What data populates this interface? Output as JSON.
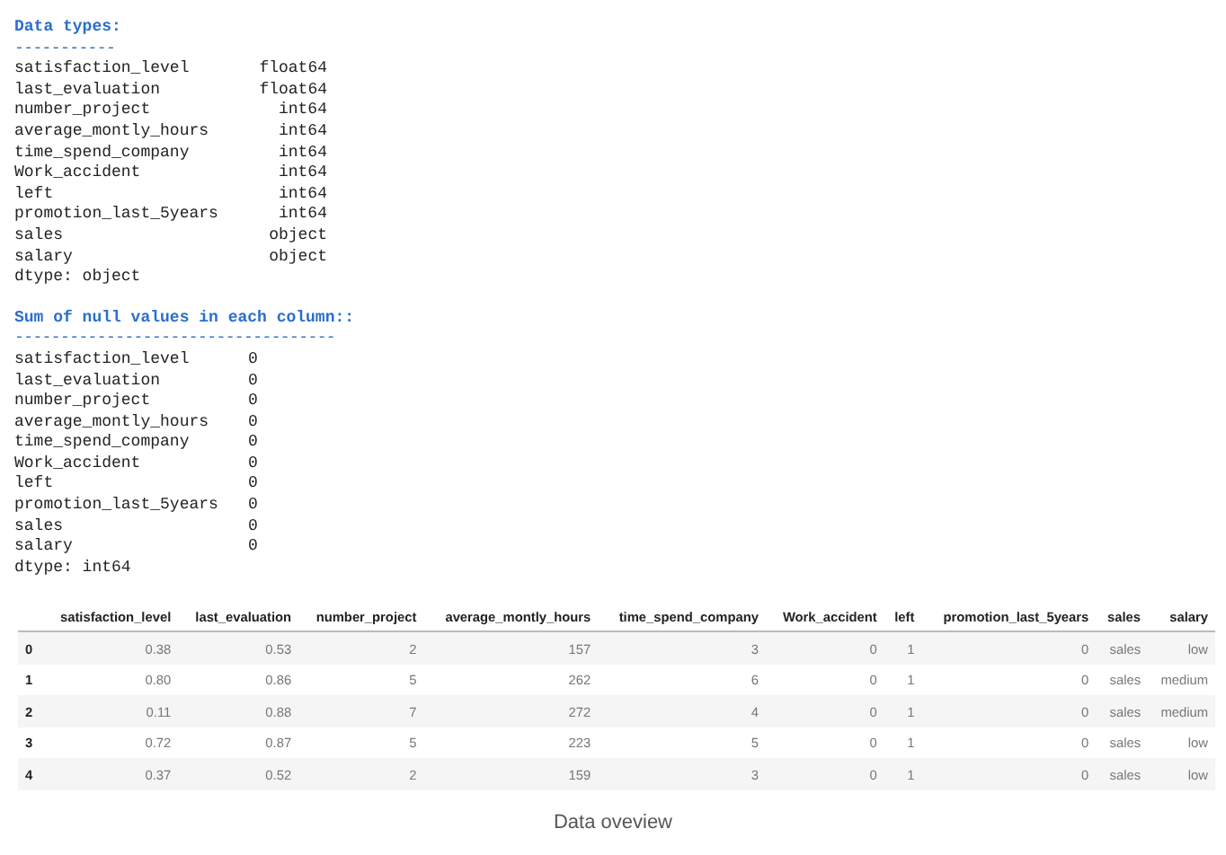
{
  "sections": [
    {
      "title": "Data types:",
      "divider": "-----------",
      "kind": "types",
      "rows": [
        {
          "name": "satisfaction_level",
          "value": "float64"
        },
        {
          "name": "last_evaluation",
          "value": "float64"
        },
        {
          "name": "number_project",
          "value": "int64"
        },
        {
          "name": "average_montly_hours",
          "value": "int64"
        },
        {
          "name": "time_spend_company",
          "value": "int64"
        },
        {
          "name": "Work_accident",
          "value": "int64"
        },
        {
          "name": "left",
          "value": "int64"
        },
        {
          "name": "promotion_last_5years",
          "value": "int64"
        },
        {
          "name": "sales",
          "value": "object"
        },
        {
          "name": "salary",
          "value": "object"
        }
      ],
      "dtype": "dtype: object"
    },
    {
      "title": "Sum of null values in each column::",
      "divider": "-----------------------------------",
      "kind": "nulls",
      "rows": [
        {
          "name": "satisfaction_level",
          "value": "0"
        },
        {
          "name": "last_evaluation",
          "value": "0"
        },
        {
          "name": "number_project",
          "value": "0"
        },
        {
          "name": "average_montly_hours",
          "value": "0"
        },
        {
          "name": "time_spend_company",
          "value": "0"
        },
        {
          "name": "Work_accident",
          "value": "0"
        },
        {
          "name": "left",
          "value": "0"
        },
        {
          "name": "promotion_last_5years",
          "value": "0"
        },
        {
          "name": "sales",
          "value": "0"
        },
        {
          "name": "salary",
          "value": "0"
        }
      ],
      "dtype": "dtype: int64"
    }
  ],
  "table": {
    "columns": [
      "satisfaction_level",
      "last_evaluation",
      "number_project",
      "average_montly_hours",
      "time_spend_company",
      "Work_accident",
      "left",
      "promotion_last_5years",
      "sales",
      "salary"
    ],
    "rows": [
      {
        "index": "0",
        "cells": [
          "0.38",
          "0.53",
          "2",
          "157",
          "3",
          "0",
          "1",
          "0",
          "sales",
          "low"
        ]
      },
      {
        "index": "1",
        "cells": [
          "0.80",
          "0.86",
          "5",
          "262",
          "6",
          "0",
          "1",
          "0",
          "sales",
          "medium"
        ]
      },
      {
        "index": "2",
        "cells": [
          "0.11",
          "0.88",
          "7",
          "272",
          "4",
          "0",
          "1",
          "0",
          "sales",
          "medium"
        ]
      },
      {
        "index": "3",
        "cells": [
          "0.72",
          "0.87",
          "5",
          "223",
          "5",
          "0",
          "1",
          "0",
          "sales",
          "low"
        ]
      },
      {
        "index": "4",
        "cells": [
          "0.37",
          "0.52",
          "2",
          "159",
          "3",
          "0",
          "1",
          "0",
          "sales",
          "low"
        ]
      }
    ]
  },
  "caption": "Data oveview"
}
